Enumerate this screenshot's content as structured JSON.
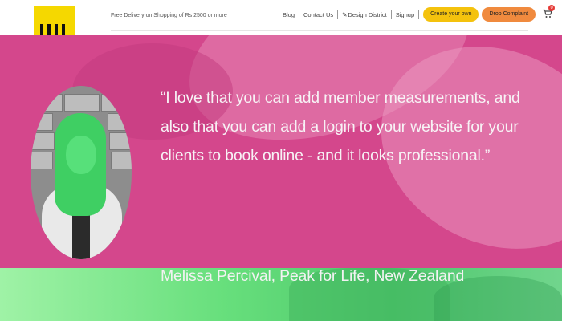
{
  "header": {
    "promo_text": "Free Delivery on Shopping of Rs 2500 or more",
    "nav": {
      "blog": "Blog",
      "contact": "Contact Us",
      "design_district": "Design District",
      "signup": "Signup"
    },
    "buttons": {
      "create_your_own": "Create your own",
      "drop_complaint": "Drop Complaint"
    },
    "cart_count": "0",
    "colors": {
      "logo": "#f5d800",
      "create_button": "#f4c20d",
      "complaint_button": "#f08a3e",
      "badge": "#e53935"
    },
    "icons": [
      "pencil-icon",
      "cart-icon"
    ]
  },
  "testimonial": {
    "quote": "“I love that you can add member measurements, and also that you can add a login to your website for your clients to book online - and it looks professional.”",
    "author": "Melissa Percival, Peak for Life, New Zealand",
    "colors": {
      "background": "#d4478c",
      "strip": "#67df7c",
      "text": "#f7f2f5"
    }
  }
}
